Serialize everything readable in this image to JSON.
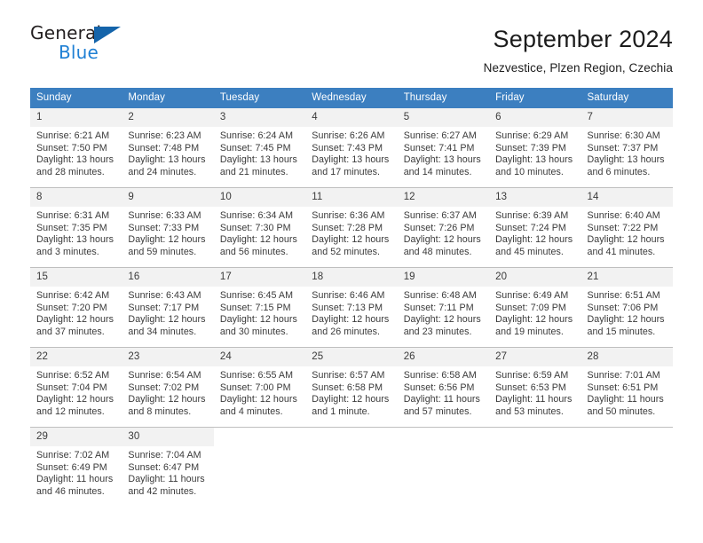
{
  "brand": {
    "name_top": "General",
    "name_bottom": "Blue",
    "accent_color": "#1e7fd4",
    "triangle_color": "#1464aa",
    "triangle_icon": "triangle-icon"
  },
  "header": {
    "title": "September 2024",
    "subtitle": "Nezvestice, Plzen Region, Czechia"
  },
  "theme": {
    "header_row_bg": "#3c7fc0",
    "daynum_bg": "#f2f2f2",
    "grid_line": "#bfbfbf",
    "text": "#3a3a3a"
  },
  "calendar": {
    "weekday_headers": [
      "Sunday",
      "Monday",
      "Tuesday",
      "Wednesday",
      "Thursday",
      "Friday",
      "Saturday"
    ],
    "weeks": [
      [
        {
          "day": "1",
          "sunrise": "Sunrise: 6:21 AM",
          "sunset": "Sunset: 7:50 PM",
          "daylight_line1": "Daylight: 13 hours",
          "daylight_line2": "and 28 minutes."
        },
        {
          "day": "2",
          "sunrise": "Sunrise: 6:23 AM",
          "sunset": "Sunset: 7:48 PM",
          "daylight_line1": "Daylight: 13 hours",
          "daylight_line2": "and 24 minutes."
        },
        {
          "day": "3",
          "sunrise": "Sunrise: 6:24 AM",
          "sunset": "Sunset: 7:45 PM",
          "daylight_line1": "Daylight: 13 hours",
          "daylight_line2": "and 21 minutes."
        },
        {
          "day": "4",
          "sunrise": "Sunrise: 6:26 AM",
          "sunset": "Sunset: 7:43 PM",
          "daylight_line1": "Daylight: 13 hours",
          "daylight_line2": "and 17 minutes."
        },
        {
          "day": "5",
          "sunrise": "Sunrise: 6:27 AM",
          "sunset": "Sunset: 7:41 PM",
          "daylight_line1": "Daylight: 13 hours",
          "daylight_line2": "and 14 minutes."
        },
        {
          "day": "6",
          "sunrise": "Sunrise: 6:29 AM",
          "sunset": "Sunset: 7:39 PM",
          "daylight_line1": "Daylight: 13 hours",
          "daylight_line2": "and 10 minutes."
        },
        {
          "day": "7",
          "sunrise": "Sunrise: 6:30 AM",
          "sunset": "Sunset: 7:37 PM",
          "daylight_line1": "Daylight: 13 hours",
          "daylight_line2": "and 6 minutes."
        }
      ],
      [
        {
          "day": "8",
          "sunrise": "Sunrise: 6:31 AM",
          "sunset": "Sunset: 7:35 PM",
          "daylight_line1": "Daylight: 13 hours",
          "daylight_line2": "and 3 minutes."
        },
        {
          "day": "9",
          "sunrise": "Sunrise: 6:33 AM",
          "sunset": "Sunset: 7:33 PM",
          "daylight_line1": "Daylight: 12 hours",
          "daylight_line2": "and 59 minutes."
        },
        {
          "day": "10",
          "sunrise": "Sunrise: 6:34 AM",
          "sunset": "Sunset: 7:30 PM",
          "daylight_line1": "Daylight: 12 hours",
          "daylight_line2": "and 56 minutes."
        },
        {
          "day": "11",
          "sunrise": "Sunrise: 6:36 AM",
          "sunset": "Sunset: 7:28 PM",
          "daylight_line1": "Daylight: 12 hours",
          "daylight_line2": "and 52 minutes."
        },
        {
          "day": "12",
          "sunrise": "Sunrise: 6:37 AM",
          "sunset": "Sunset: 7:26 PM",
          "daylight_line1": "Daylight: 12 hours",
          "daylight_line2": "and 48 minutes."
        },
        {
          "day": "13",
          "sunrise": "Sunrise: 6:39 AM",
          "sunset": "Sunset: 7:24 PM",
          "daylight_line1": "Daylight: 12 hours",
          "daylight_line2": "and 45 minutes."
        },
        {
          "day": "14",
          "sunrise": "Sunrise: 6:40 AM",
          "sunset": "Sunset: 7:22 PM",
          "daylight_line1": "Daylight: 12 hours",
          "daylight_line2": "and 41 minutes."
        }
      ],
      [
        {
          "day": "15",
          "sunrise": "Sunrise: 6:42 AM",
          "sunset": "Sunset: 7:20 PM",
          "daylight_line1": "Daylight: 12 hours",
          "daylight_line2": "and 37 minutes."
        },
        {
          "day": "16",
          "sunrise": "Sunrise: 6:43 AM",
          "sunset": "Sunset: 7:17 PM",
          "daylight_line1": "Daylight: 12 hours",
          "daylight_line2": "and 34 minutes."
        },
        {
          "day": "17",
          "sunrise": "Sunrise: 6:45 AM",
          "sunset": "Sunset: 7:15 PM",
          "daylight_line1": "Daylight: 12 hours",
          "daylight_line2": "and 30 minutes."
        },
        {
          "day": "18",
          "sunrise": "Sunrise: 6:46 AM",
          "sunset": "Sunset: 7:13 PM",
          "daylight_line1": "Daylight: 12 hours",
          "daylight_line2": "and 26 minutes."
        },
        {
          "day": "19",
          "sunrise": "Sunrise: 6:48 AM",
          "sunset": "Sunset: 7:11 PM",
          "daylight_line1": "Daylight: 12 hours",
          "daylight_line2": "and 23 minutes."
        },
        {
          "day": "20",
          "sunrise": "Sunrise: 6:49 AM",
          "sunset": "Sunset: 7:09 PM",
          "daylight_line1": "Daylight: 12 hours",
          "daylight_line2": "and 19 minutes."
        },
        {
          "day": "21",
          "sunrise": "Sunrise: 6:51 AM",
          "sunset": "Sunset: 7:06 PM",
          "daylight_line1": "Daylight: 12 hours",
          "daylight_line2": "and 15 minutes."
        }
      ],
      [
        {
          "day": "22",
          "sunrise": "Sunrise: 6:52 AM",
          "sunset": "Sunset: 7:04 PM",
          "daylight_line1": "Daylight: 12 hours",
          "daylight_line2": "and 12 minutes."
        },
        {
          "day": "23",
          "sunrise": "Sunrise: 6:54 AM",
          "sunset": "Sunset: 7:02 PM",
          "daylight_line1": "Daylight: 12 hours",
          "daylight_line2": "and 8 minutes."
        },
        {
          "day": "24",
          "sunrise": "Sunrise: 6:55 AM",
          "sunset": "Sunset: 7:00 PM",
          "daylight_line1": "Daylight: 12 hours",
          "daylight_line2": "and 4 minutes."
        },
        {
          "day": "25",
          "sunrise": "Sunrise: 6:57 AM",
          "sunset": "Sunset: 6:58 PM",
          "daylight_line1": "Daylight: 12 hours",
          "daylight_line2": "and 1 minute."
        },
        {
          "day": "26",
          "sunrise": "Sunrise: 6:58 AM",
          "sunset": "Sunset: 6:56 PM",
          "daylight_line1": "Daylight: 11 hours",
          "daylight_line2": "and 57 minutes."
        },
        {
          "day": "27",
          "sunrise": "Sunrise: 6:59 AM",
          "sunset": "Sunset: 6:53 PM",
          "daylight_line1": "Daylight: 11 hours",
          "daylight_line2": "and 53 minutes."
        },
        {
          "day": "28",
          "sunrise": "Sunrise: 7:01 AM",
          "sunset": "Sunset: 6:51 PM",
          "daylight_line1": "Daylight: 11 hours",
          "daylight_line2": "and 50 minutes."
        }
      ],
      [
        {
          "day": "29",
          "sunrise": "Sunrise: 7:02 AM",
          "sunset": "Sunset: 6:49 PM",
          "daylight_line1": "Daylight: 11 hours",
          "daylight_line2": "and 46 minutes."
        },
        {
          "day": "30",
          "sunrise": "Sunrise: 7:04 AM",
          "sunset": "Sunset: 6:47 PM",
          "daylight_line1": "Daylight: 11 hours",
          "daylight_line2": "and 42 minutes."
        },
        {
          "day": "",
          "sunrise": "",
          "sunset": "",
          "daylight_line1": "",
          "daylight_line2": ""
        },
        {
          "day": "",
          "sunrise": "",
          "sunset": "",
          "daylight_line1": "",
          "daylight_line2": ""
        },
        {
          "day": "",
          "sunrise": "",
          "sunset": "",
          "daylight_line1": "",
          "daylight_line2": ""
        },
        {
          "day": "",
          "sunrise": "",
          "sunset": "",
          "daylight_line1": "",
          "daylight_line2": ""
        },
        {
          "day": "",
          "sunrise": "",
          "sunset": "",
          "daylight_line1": "",
          "daylight_line2": ""
        }
      ]
    ]
  }
}
